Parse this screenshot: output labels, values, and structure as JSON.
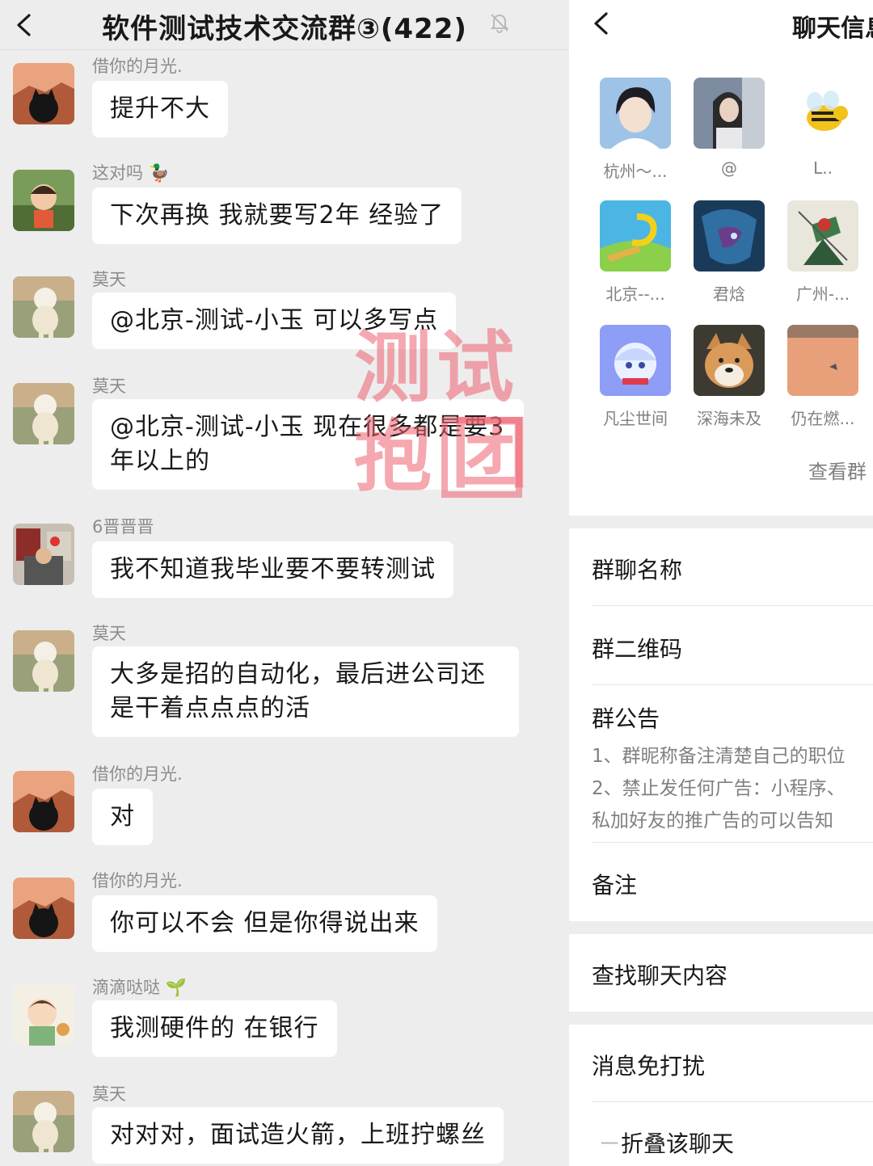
{
  "chat": {
    "title": "软件测试技术交流群③(422)",
    "watermark": {
      "line1": "测试",
      "line2_a": "抱",
      "line2_b": "团"
    },
    "messages": [
      {
        "sender": "借你的月光.",
        "text": "提升不大"
      },
      {
        "sender": "这对吗",
        "text": "下次再换 我就要写2年 经验了"
      },
      {
        "sender": "莫天",
        "text": "@北京-测试-小玉 可以多写点"
      },
      {
        "sender": "莫天",
        "text": "@北京-测试-小玉 现在很多都是要3年以上的"
      },
      {
        "sender": "6晋晋晋",
        "text": "我不知道我毕业要不要转测试"
      },
      {
        "sender": "莫天",
        "text": "大多是招的自动化，最后进公司还是干着点点点的活"
      },
      {
        "sender": "借你的月光.",
        "text": "对"
      },
      {
        "sender": "借你的月光.",
        "text": "你可以不会 但是你得说出来"
      },
      {
        "sender": "滴滴哒哒",
        "text": "我测硬件的 在银行"
      },
      {
        "sender": "莫天",
        "text": "对对对，面试造火箭，上班拧螺丝"
      }
    ]
  },
  "info": {
    "title": "聊天信息",
    "members": [
      {
        "name": "杭州～..."
      },
      {
        "name": "@"
      },
      {
        "name": "L.."
      },
      {
        "name": "北京--..."
      },
      {
        "name": "君焓"
      },
      {
        "name": "广州-..."
      },
      {
        "name": "凡尘世间"
      },
      {
        "name": "深海未及"
      },
      {
        "name": "仍在燃..."
      }
    ],
    "view_more": "查看群",
    "rows": {
      "group_name": "群聊名称",
      "qr_code": "群二维码",
      "notice": "群公告",
      "notice_lines": [
        "1、群昵称备注清楚自己的职位",
        "2、禁止发任何广告：小程序、",
        "私加好友的推广告的可以告知"
      ],
      "remark": "备注",
      "search": "查找聊天内容",
      "mute": "消息免打扰",
      "fold": "折叠该聊天"
    }
  }
}
